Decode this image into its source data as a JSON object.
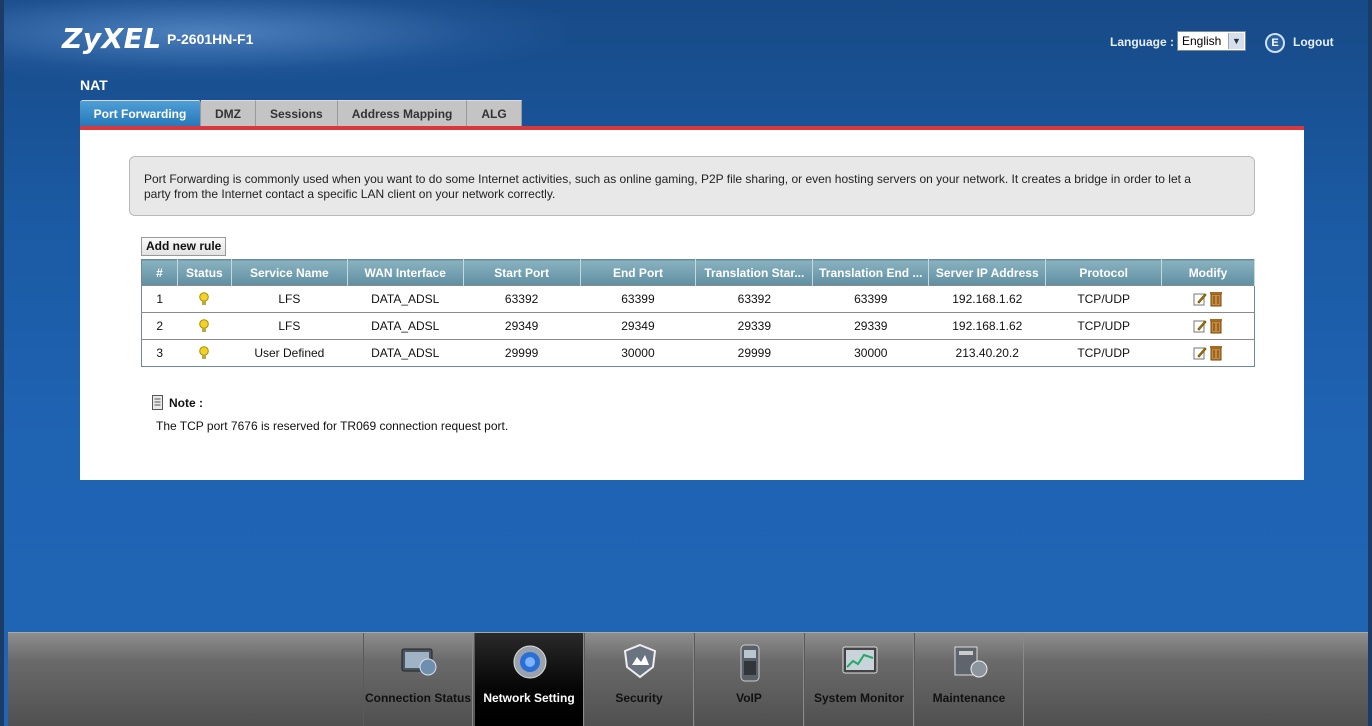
{
  "header": {
    "brand": "ZyXEL",
    "model": "P-2601HN-F1",
    "language_label": "Language :",
    "language_value": "English",
    "logout_label": "Logout"
  },
  "page": {
    "title": "NAT",
    "tabs": [
      "Port Forwarding",
      "DMZ",
      "Sessions",
      "Address Mapping",
      "ALG"
    ],
    "active_tab": "Port Forwarding"
  },
  "info": {
    "line1": "Port Forwarding is commonly used when you want to do some Internet activities, such as online gaming, P2P file sharing, or even hosting servers on your network. It creates a bridge in order to let a",
    "line2": "party from the Internet contact a specific LAN client on your network correctly."
  },
  "add_rule_label": "Add new rule",
  "table": {
    "columns": [
      "#",
      "Status",
      "Service Name",
      "WAN Interface",
      "Start Port",
      "End Port",
      "Translation Star...",
      "Translation End ...",
      "Server IP Address",
      "Protocol",
      "Modify"
    ],
    "rows": [
      [
        "1",
        "",
        "LFS",
        "DATA_ADSL",
        "63392",
        "63399",
        "63392",
        "63399",
        "192.168.1.62",
        "TCP/UDP",
        ""
      ],
      [
        "2",
        "",
        "LFS",
        "DATA_ADSL",
        "29349",
        "29349",
        "29339",
        "29339",
        "192.168.1.62",
        "TCP/UDP",
        ""
      ],
      [
        "3",
        "",
        "User Defined",
        "DATA_ADSL",
        "29999",
        "30000",
        "29999",
        "30000",
        "213.40.20.2",
        "TCP/UDP",
        ""
      ]
    ]
  },
  "note": {
    "label": "Note :",
    "text": "The TCP port 7676 is reserved for TR069 connection request port."
  },
  "nav": {
    "items": [
      "Connection Status",
      "Network Setting",
      "Security",
      "VoIP",
      "System Monitor",
      "Maintenance"
    ],
    "active": "Network Setting",
    "icons": [
      "connection-status-icon",
      "network-setting-icon",
      "security-icon",
      "voip-icon",
      "system-monitor-icon",
      "maintenance-icon"
    ]
  },
  "colors": {
    "background": "#1f5fa8",
    "tab_active": "#2678b8",
    "accent_red": "#d9363e",
    "table_header": "#6f9bac",
    "status_bulb": "#f2d227"
  }
}
